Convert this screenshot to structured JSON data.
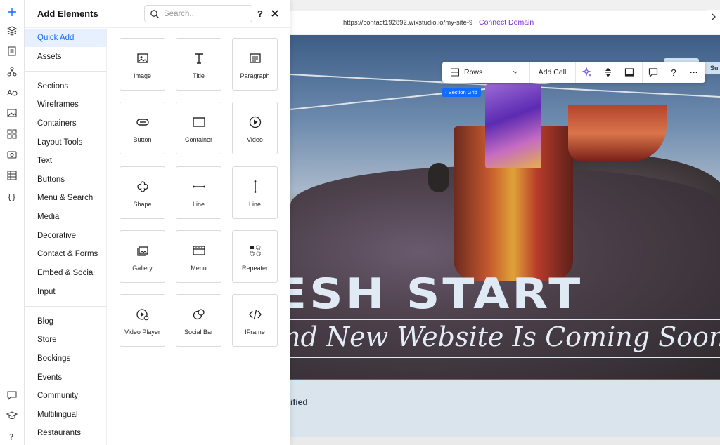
{
  "panel": {
    "title": "Add Elements",
    "search_placeholder": "Search...",
    "help": "?"
  },
  "categories": {
    "group1": [
      "Quick Add",
      "Assets"
    ],
    "group2": [
      "Sections",
      "Wireframes",
      "Containers",
      "Layout Tools",
      "Text",
      "Buttons",
      "Menu & Search",
      "Media",
      "Decorative",
      "Contact & Forms",
      "Embed & Social",
      "Input"
    ],
    "group3": [
      "Blog",
      "Store",
      "Bookings",
      "Events",
      "Community",
      "Multilingual",
      "Restaurants"
    ],
    "active": "Quick Add"
  },
  "tiles": [
    {
      "label": "Image",
      "icon": "image-icon"
    },
    {
      "label": "Title",
      "icon": "title-icon"
    },
    {
      "label": "Paragraph",
      "icon": "paragraph-icon"
    },
    {
      "label": "Button",
      "icon": "button-icon"
    },
    {
      "label": "Container",
      "icon": "container-icon"
    },
    {
      "label": "Video",
      "icon": "video-icon"
    },
    {
      "label": "Shape",
      "icon": "shape-icon"
    },
    {
      "label": "Line",
      "icon": "horizontal-line-icon"
    },
    {
      "label": "Line",
      "icon": "vertical-line-icon"
    },
    {
      "label": "Gallery",
      "icon": "gallery-icon"
    },
    {
      "label": "Menu",
      "icon": "menu-icon"
    },
    {
      "label": "Repeater",
      "icon": "repeater-icon"
    },
    {
      "label": "Video Player",
      "icon": "video-player-icon"
    },
    {
      "label": "Social Bar",
      "icon": "social-bar-icon"
    },
    {
      "label": "IFrame",
      "icon": "iframe-icon"
    }
  ],
  "topbar": {
    "url": "https://contact192892.wixstudio.io/my-site-9",
    "connect_domain": "Connect Domain"
  },
  "toolbar": {
    "layout_select": "Rows",
    "add_cell": "Add Cell",
    "section_grid_tag": "Section Grid",
    "help": "?",
    "more": "···"
  },
  "hero": {
    "title": "ESH START",
    "subtitle": "nd New Website Is Coming Soon"
  },
  "band": {
    "text": "ified",
    "pill": "Su"
  },
  "colors": {
    "accent": "#116dff",
    "connect": "#7b2fd6",
    "band": "#d9e4ec"
  }
}
